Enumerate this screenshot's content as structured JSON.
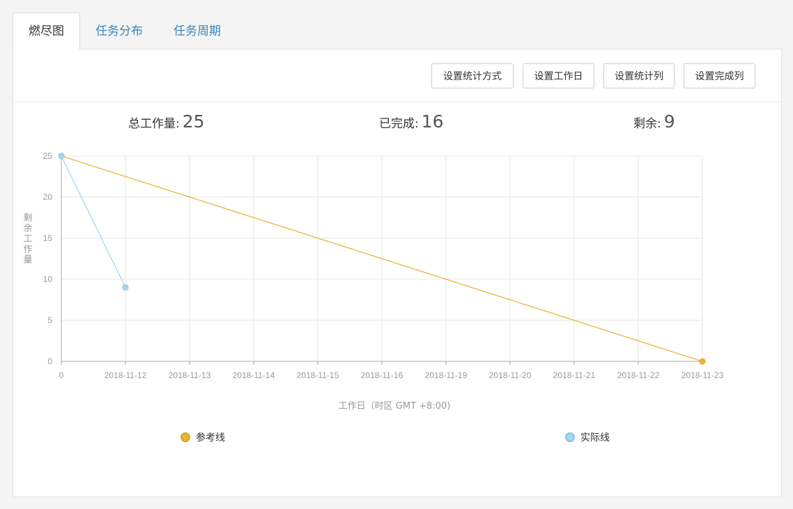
{
  "tabs": [
    {
      "label": "燃尽图",
      "active": true
    },
    {
      "label": "任务分布",
      "active": false
    },
    {
      "label": "任务周期",
      "active": false
    }
  ],
  "toolbar": {
    "buttons": [
      "设置统计方式",
      "设置工作日",
      "设置统计列",
      "设置完成列"
    ]
  },
  "summary": {
    "total_label": "总工作量:",
    "total_value": "25",
    "done_label": "已完成:",
    "done_value": "16",
    "remain_label": "剩余:",
    "remain_value": "9"
  },
  "colors": {
    "reference": "#e8b63a",
    "actual": "#a8d4ee",
    "grid": "#e6e6e6",
    "axis": "#aaaaaa"
  },
  "chart_data": {
    "type": "line",
    "categories": [
      "0",
      "2018-11-12",
      "2018-11-13",
      "2018-11-14",
      "2018-11-15",
      "2018-11-16",
      "2018-11-19",
      "2018-11-20",
      "2018-11-21",
      "2018-11-22",
      "2018-11-23"
    ],
    "ylim": [
      0,
      25
    ],
    "yticks": [
      0,
      5,
      10,
      15,
      20,
      25
    ],
    "ylabel": "剩余工作量",
    "xlabel": "工作日（时区 GMT +8:00)",
    "series": [
      {
        "name": "参考线",
        "values": [
          25,
          null,
          null,
          null,
          null,
          null,
          null,
          null,
          null,
          null,
          0
        ],
        "markers": [
          true,
          false,
          false,
          false,
          false,
          false,
          false,
          false,
          false,
          false,
          true
        ]
      },
      {
        "name": "实际线",
        "values": [
          25,
          9,
          null,
          null,
          null,
          null,
          null,
          null,
          null,
          null,
          null
        ],
        "markers": [
          true,
          true,
          false,
          false,
          false,
          false,
          false,
          false,
          false,
          false,
          false
        ]
      }
    ],
    "legend": "bottom",
    "grid": true
  }
}
